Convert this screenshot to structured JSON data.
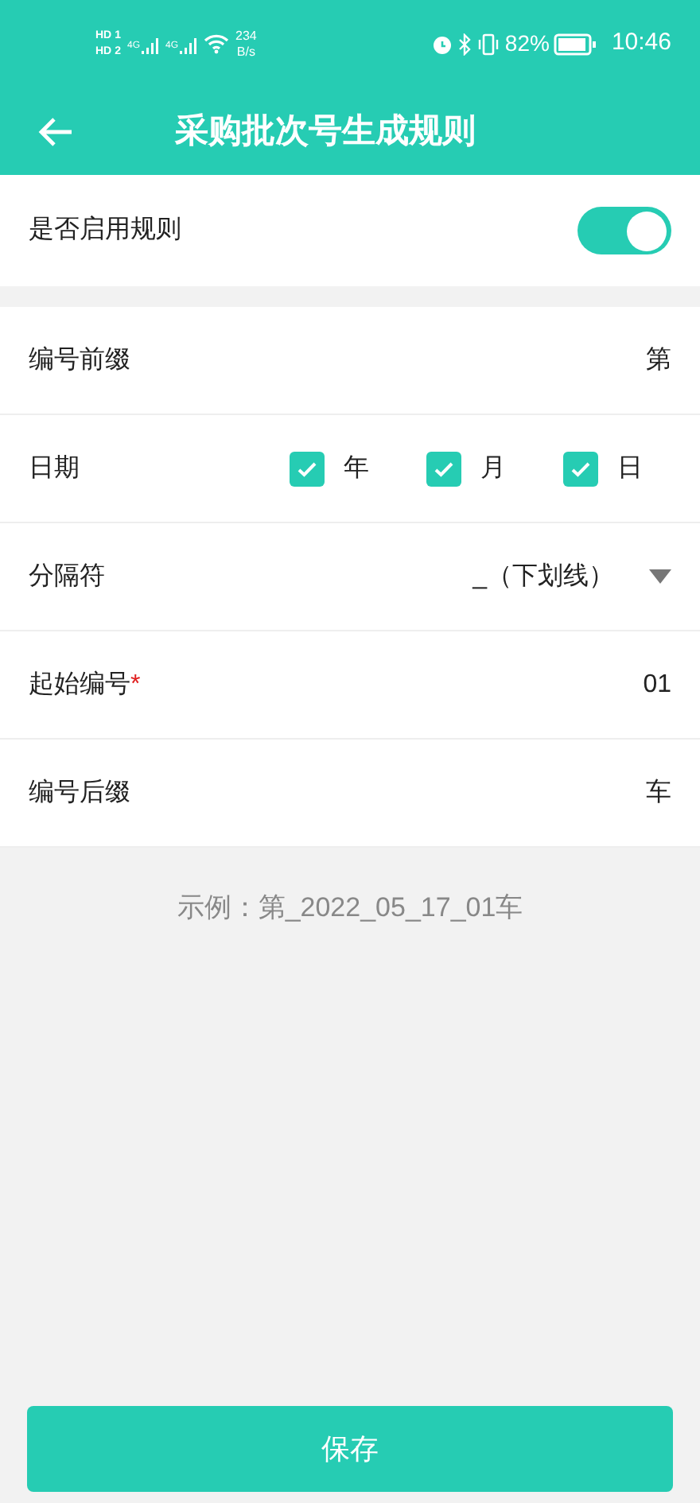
{
  "status_bar": {
    "sim_labels": [
      "HD",
      "1",
      "HD",
      "2"
    ],
    "network": [
      "4G",
      "4G"
    ],
    "speed": [
      "234",
      "B/s"
    ],
    "battery": "82%",
    "time": "10:46"
  },
  "header": {
    "title": "采购批次号生成规则"
  },
  "enable_rule": {
    "label": "是否启用规则",
    "on": true
  },
  "fields": [
    {
      "kind": "text",
      "label": "编号前缀",
      "value": "第"
    },
    {
      "kind": "checks",
      "label": "日期",
      "options": [
        {
          "label": "年",
          "checked": true
        },
        {
          "label": "月",
          "checked": true
        },
        {
          "label": "日",
          "checked": true
        }
      ]
    },
    {
      "kind": "select",
      "label": "分隔符",
      "value": "_（下划线）"
    },
    {
      "kind": "text",
      "label": "起始编号",
      "value": "01",
      "required_mark": "*"
    },
    {
      "kind": "text",
      "label": "编号后缀",
      "value": "车"
    }
  ],
  "example": "示例：第_2022_05_17_01车",
  "save_button": "保存"
}
